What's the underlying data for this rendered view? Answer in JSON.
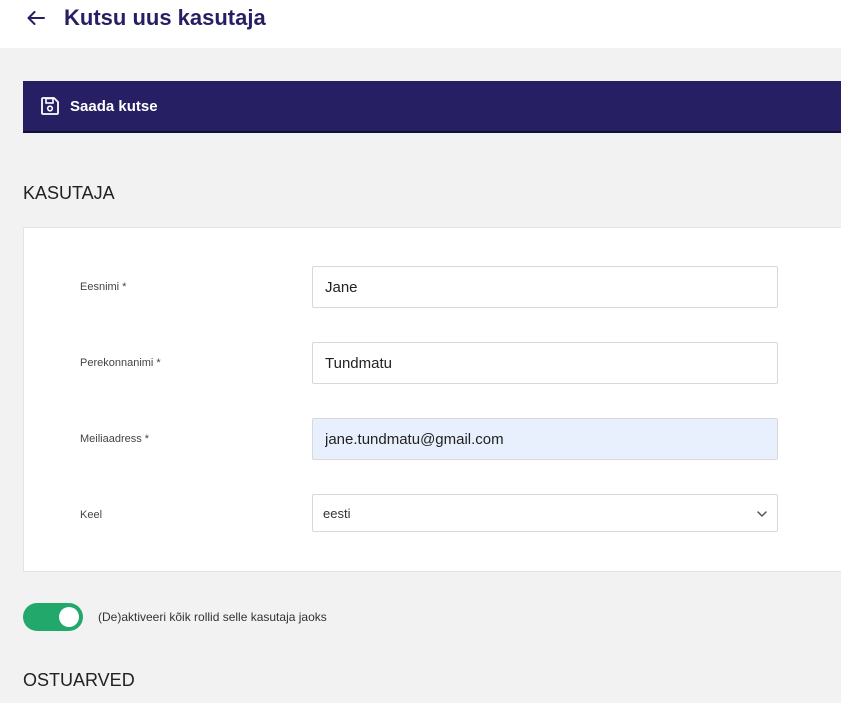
{
  "header": {
    "back_icon": "arrow-left-icon",
    "title": "Kutsu uus kasutaja"
  },
  "toolbar": {
    "save_icon": "floppy-disk-icon",
    "save_label": "Saada kutse"
  },
  "user_section": {
    "title": "KASUTAJA",
    "fields": {
      "first_name": {
        "label": "Eesnimi *",
        "value": "Jane"
      },
      "last_name": {
        "label": "Perekonnanimi *",
        "value": "Tundmatu"
      },
      "email": {
        "label": "Meiliaadress *",
        "value": "jane.tundmatu@gmail.com"
      },
      "language": {
        "label": "Keel",
        "value": "eesti"
      }
    }
  },
  "roles_toggle": {
    "state": "on",
    "label": "(De)aktiveeri kõik rollid selle kasutaja jaoks"
  },
  "invoices_section": {
    "title": "OSTUARVED"
  },
  "colors": {
    "primary": "#261f63",
    "toggle_on": "#21a86a",
    "autofill_bg": "#e8f0fe"
  }
}
